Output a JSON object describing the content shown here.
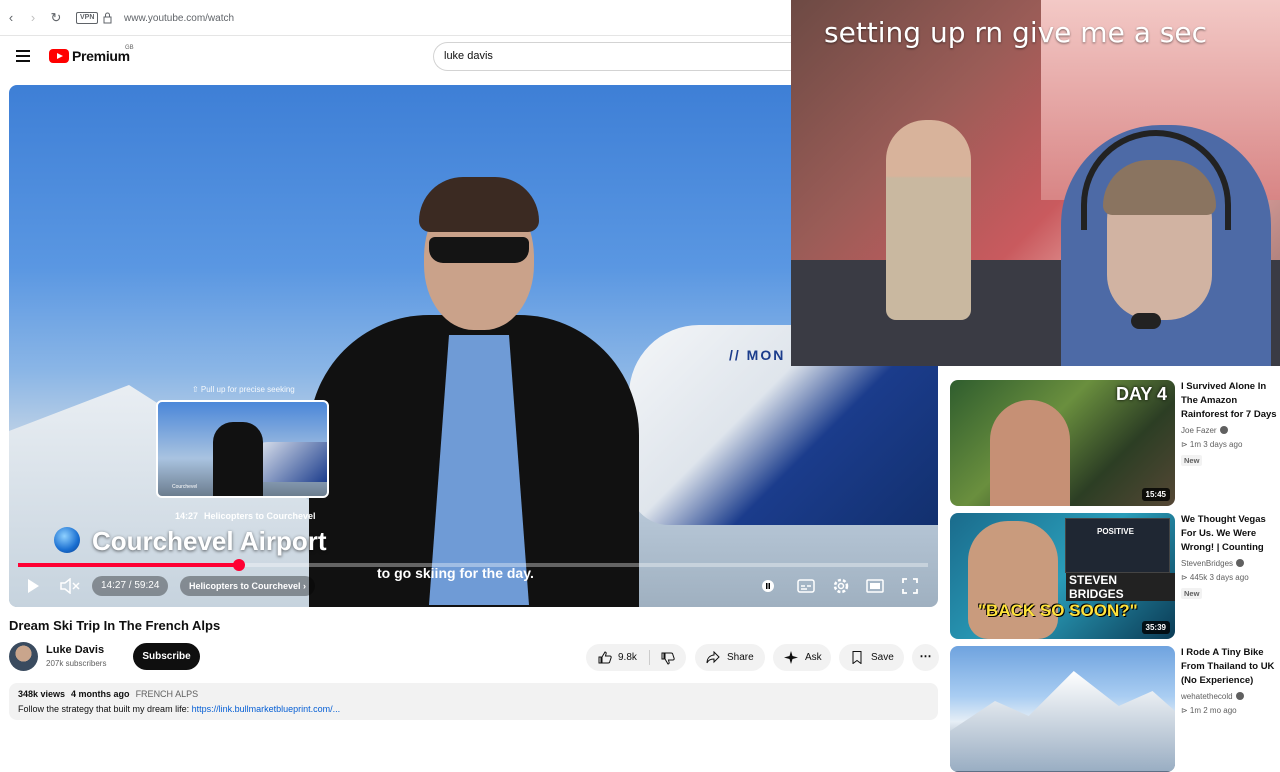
{
  "browser": {
    "vpn_label": "VPN",
    "url": "www.youtube.com/watch"
  },
  "masthead": {
    "logo_text": "Premium",
    "region": "GB",
    "search_value": "luke davis"
  },
  "player": {
    "seek_hint": "⇧ Pull up for precise seeking",
    "preview_label": "Courchevel",
    "hover_time": "14:27",
    "hover_chapter": "Helicopters to Courchevel",
    "location_title": "Courchevel Airport",
    "subtitle": "to go skiing for the day.",
    "current_time": "14:27",
    "duration": "59:24",
    "progress_fraction": 0.243,
    "chapter_pill": "Helicopters to Courchevel ›",
    "accent_color": "#ff0033"
  },
  "video": {
    "title": "Dream Ski Trip In The French Alps",
    "channel_name": "Luke Davis",
    "subscribers": "207k subscribers",
    "subscribe_label": "Subscribe",
    "like_count": "9.8k",
    "share_label": "Share",
    "ask_label": "Ask",
    "save_label": "Save",
    "more_label": "⋯",
    "views": "348k views",
    "uploaded": "4 months ago",
    "tag": "FRENCH ALPS",
    "description_prefix": "Follow the strategy that built my dream life:",
    "description_link": "https://link.bullmarketblueprint.com/..."
  },
  "recommendations": [
    {
      "title": "I Survived Alone In The Amazon Rainforest for 7 Days",
      "channel": "Joe Fazer",
      "meta": "⊳ 1m  3 days ago",
      "badge": "New",
      "duration": "15:45",
      "thumb_text": "DAY 4"
    },
    {
      "title": "We Thought Vegas For Us. We Were Wrong! | Counting",
      "channel": "StevenBridges",
      "meta": "⊳ 445k  3 days ago",
      "badge": "New",
      "duration": "35:39",
      "thumb_text": "\"BACK SO SOON?\"",
      "thumb_name": "STEVEN BRIDGES",
      "thumb_inset": "POSITIVE"
    },
    {
      "title": "I Rode A Tiny Bike From Thailand to UK (No Experience)",
      "channel": "wehatethecold",
      "meta": "⊳ 1m  2 mo ago"
    }
  ],
  "overlay": {
    "caption": "setting up rn give me a sec"
  }
}
